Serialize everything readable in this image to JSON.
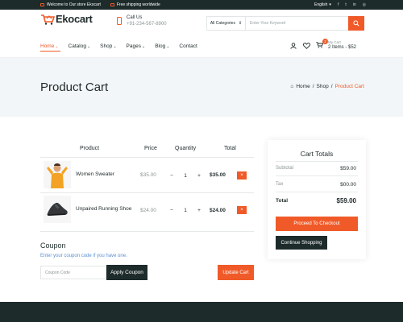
{
  "topbar": {
    "welcome": "Welcome to Our store Ekocart",
    "shipping": "Free shipping worldwide",
    "language": "English"
  },
  "brand": {
    "name": "Ekocart",
    "accent": "#f05a28",
    "dark": "#1d2b2b"
  },
  "call": {
    "label": "Call Us",
    "number": "+91-234-567-8900"
  },
  "search": {
    "category": "All Categories",
    "placeholder": "Enter Your Keyword"
  },
  "nav": {
    "home": "Home",
    "catalog": "Catalog",
    "shop": "Shop",
    "pages": "Pages",
    "blog": "Blog",
    "contact": "Contact"
  },
  "cart_summary": {
    "badge": "2",
    "label": "My Cart",
    "items": "2 Items - $52"
  },
  "banner": {
    "title": "Product Cart",
    "crumb_home": "Home",
    "crumb_shop": "Shop",
    "crumb_current": "Product Cart",
    "sep": "/"
  },
  "table": {
    "headers": {
      "product": "Product",
      "price": "Price",
      "quantity": "Quantity",
      "total": "Total"
    },
    "rows": [
      {
        "name": "Women Sweater",
        "price": "$35.00",
        "qty": "1",
        "total": "$35.00"
      },
      {
        "name": "Unpaired Running Shoe",
        "price": "$24.00",
        "qty": "1",
        "total": "$24.00"
      }
    ],
    "minus": "−",
    "plus": "+",
    "remove": "×"
  },
  "coupon": {
    "heading": "Coupon",
    "subtext": "Enter your coupon code if you have one.",
    "placeholder": "Coupon Code",
    "apply": "Apply Coupon",
    "update": "Update Cart"
  },
  "totals": {
    "title": "Cart Totals",
    "subtotal_label": "Subtotal",
    "subtotal": "$59.00",
    "tax_label": "Tax",
    "tax": "$00.00",
    "total_label": "Total",
    "total": "$59.00",
    "checkout": "Proceed To Checkout",
    "continue": "Continue Shopping"
  }
}
